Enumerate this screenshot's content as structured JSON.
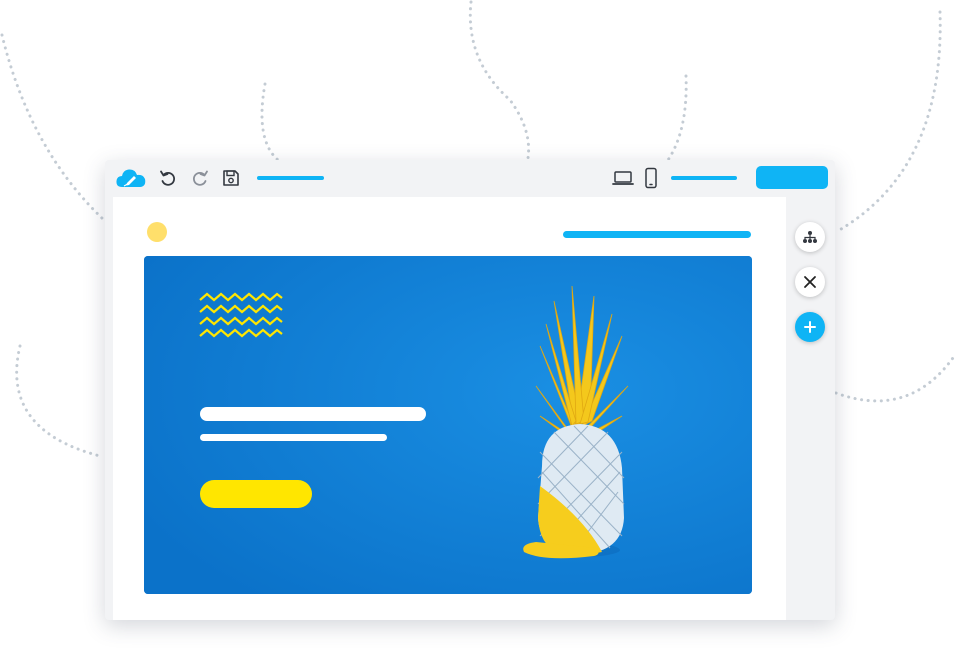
{
  "colors": {
    "accent": "#0fb4f5",
    "hero_background": "#0d7fd6",
    "yellow": "#ffe600",
    "logo_yellow": "#ffdf6b",
    "icon_gray": "#333840",
    "dotted_line": "#c4ccd4"
  },
  "toolbar": {
    "logo_icon": "cloud-pen-icon",
    "undo_icon": "undo-icon",
    "redo_icon": "redo-icon",
    "save_icon": "save-icon",
    "desktop_icon": "laptop-icon",
    "mobile_icon": "mobile-icon"
  },
  "sidebar": {
    "items": [
      {
        "icon": "sitemap-icon"
      },
      {
        "icon": "close-icon"
      },
      {
        "icon": "plus-icon"
      }
    ]
  },
  "hero": {
    "decoration_icon": "zigzag-lines-icon",
    "image": "yellow-pineapple-illustration"
  }
}
